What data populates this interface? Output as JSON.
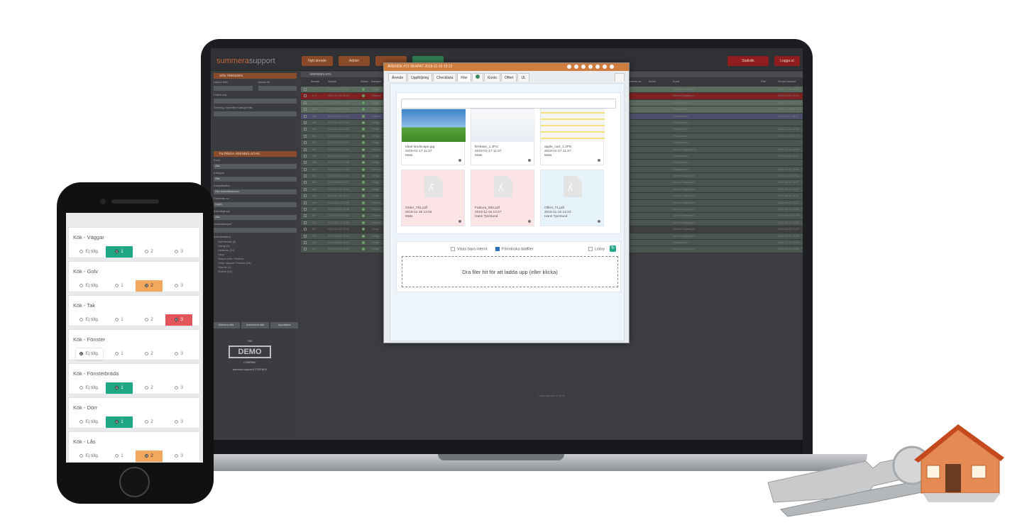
{
  "app": {
    "logo_main": "summera",
    "logo_sub": "support",
    "btn_statistik": "Statistik",
    "btn_logout": "Logga ut",
    "btn_new": "Nytt ärende",
    "btn_admin": "Admin",
    "btn_3": "",
    "btn_4": ""
  },
  "sidebar": {
    "search_header": "SÖK ÄRENDEN",
    "date_from": "Datum från",
    "date_to": "Datum till",
    "free_text": "Fritext sök",
    "search_category": "Sökning i specifikt Kategori fält",
    "filter_header": "FILTRERA ÄRENDELISTAN",
    "kund_label": "Kund",
    "kund_value": "Alla",
    "kategori_label": "Kategori",
    "kategori_value": "Alla",
    "klass_label": "Klassifikation",
    "klass_value": "Alla klassifikationer",
    "handled_label": "Hanteras av",
    "handled_value": "Ingen",
    "group_label": "Ärendegrupp",
    "group_value": "Alla",
    "sub_label": "Underkategori",
    "legend_header": "Ärendestatus",
    "legend": [
      "Nytt ärende (8)",
      "Stängt (3)",
      "Hanteras (14)",
      "Lång",
      "Skapa order i Fortnox",
      "Order skapad i Fortnox (26)",
      "Vilande (1)",
      "Slutfört (21)"
    ],
    "btn_mark_all": "Markera alla",
    "btn_unmark_all": "Avmarkera alla",
    "btn_update": "Uppdatera",
    "demo_the": "THE",
    "demo_main": "DEMO",
    "demo_company": "COMPANY",
    "demo_footer": "summera support & FORTNOX"
  },
  "list": {
    "header": "ÄRENDELISTA",
    "columns": [
      "Ärende",
      "Skapat",
      "Status",
      "Kategori",
      "Hanteras av",
      "Ämne",
      "Kund",
      "Filer",
      "Senast ändrad"
    ],
    "rows": [
      {
        "id": "#70",
        "date": "2019-11-28 13:29",
        "cat": "Övrigt",
        "kund": "Demo Company 07",
        "ch": "2019-12-12 08:52",
        "color": "#5a6a5f"
      },
      {
        "id": "#71",
        "date": "2019-11-15 13:12",
        "cat": "Felanm",
        "kund": "Demo Company 6",
        "ch": "2019-11-15 13:23",
        "color": "#7d2121"
      },
      {
        "id": "#70",
        "date": "2019-11-01 14:23",
        "cat": "Övrigt",
        "kund": "Privatperson",
        "ch": "2019-11-15 10:41",
        "color": "#5a6a5f"
      },
      {
        "id": "#69",
        "date": "2019-10-30 16:16",
        "cat": "Övrigt",
        "kund": "Privatperson",
        "ch": "2019-11-15 12:59",
        "color": "#5a6a5f"
      },
      {
        "id": "#68",
        "date": "2019-10-17 14:27",
        "cat": "Felanm",
        "kund": "Privatperson",
        "ch": "2019-11-14 08:17",
        "color": "#4e4d6b"
      },
      {
        "id": "#65",
        "date": "2019-10-16 14:34",
        "cat": "Övrigt",
        "kund": "Privatperson",
        "ch": "",
        "color": "#4b5550"
      },
      {
        "id": "#64",
        "date": "2019-10-16 14:28",
        "cat": "Övrigt",
        "kund": "Privatperson",
        "ch": "2019-10-26 14:28",
        "color": "#4b5550"
      },
      {
        "id": "#63",
        "date": "2019-10-16 12:03",
        "cat": "Övrigt",
        "kund": "Privatperson",
        "ch": "2019-10-26 12:03",
        "color": "#4b5550"
      },
      {
        "id": "#62",
        "date": "2019-10-17 15:31",
        "cat": "Övrigt",
        "kund": "Privatperson",
        "ch": "",
        "color": "#4b5550"
      },
      {
        "id": "#61",
        "date": "2019-10-11 17:15",
        "cat": "Felanm",
        "kund": "Demo Company 23",
        "ch": "2019-10-16 14:29",
        "color": "#4b5550"
      },
      {
        "id": "#59",
        "date": "2019-10-01 12:44",
        "cat": "Övrigt",
        "kund": "Privatperson",
        "ch": "2019-10-26 13:11",
        "color": "#4b5550"
      },
      {
        "id": "#58",
        "date": "2019-10-01 12:38",
        "cat": "Övrigt",
        "kund": "Privatperson",
        "ch": "",
        "color": "#4b5550"
      },
      {
        "id": "#57",
        "date": "2019-10-01 12:33",
        "cat": "Felanm",
        "kund": "Privatperson",
        "ch": "2019-10-17 15:32",
        "color": "#4b5550"
      },
      {
        "id": "#53",
        "date": "2019-09-12 13:24",
        "cat": "Övrigt",
        "kund": "Demo Company 6",
        "ch": "2019-12-03 13:01",
        "color": "#4b5550"
      },
      {
        "id": "#50",
        "date": "2019-09-05 15:07",
        "cat": "Övrigt",
        "kund": "Demo Company 6",
        "ch": "2019-09-11 13:57",
        "color": "#4b5550"
      },
      {
        "id": "#44",
        "date": "2019-07-18 16:40",
        "cat": "Övrigt",
        "kund": "Demo Company 6",
        "ch": "2019-08-15 13:37",
        "color": "#4b5550"
      },
      {
        "id": "#42",
        "date": "2019-07-18 16:03",
        "cat": "Övrigt",
        "kund": "Demo Company 6",
        "ch": "2019-09-11 13:37",
        "color": "#4b5550"
      },
      {
        "id": "#39",
        "date": "2019-06-27 15:46",
        "cat": "Felanm",
        "kund": "Demo Company 6",
        "ch": "2019-09-09 13:11",
        "color": "#4b5550"
      },
      {
        "id": "#38",
        "date": "2019-06-04 15:48",
        "cat": "Felanm",
        "kund": "Demo Company 3",
        "ch": "2019-06-25 13:00",
        "color": "#4b5550"
      },
      {
        "id": "#37",
        "date": "2019-06-03 15:55",
        "cat": "Felanm",
        "kund": "Demo Company 6",
        "ch": "2019-06-03 10:05",
        "color": "#4b5550"
      },
      {
        "id": "#33",
        "date": "2019-05-14 12:55",
        "cat": "Service",
        "kund": "Demo Company 6",
        "ch": "2019-05-25 13:58",
        "color": "#4b5550"
      },
      {
        "id": "#27",
        "date": "2019-04-26 09:45",
        "cat": "Övrigt",
        "kund": "Demo Company 6",
        "ch": "2019-04-28 13:23",
        "color": "#3e403f"
      },
      {
        "id": "#23",
        "date": "2019-04-26 15:15",
        "cat": "Övrigt",
        "kund": "Demo Company 6",
        "ch": "2019-10-15 15:08",
        "color": "#4b5550"
      },
      {
        "id": "#22",
        "date": "2019-04-25 16:03",
        "cat": "Övrigt",
        "kund": "Privatperson",
        "ch": "2019-07-17 14:29",
        "color": "#4b5550"
      },
      {
        "id": "#1",
        "date": "2019-04-24 13:39",
        "cat": "Övrigt",
        "kund": "Demo Company 6",
        "ch": "2019-04-24 13:36",
        "color": "#4b5550"
      }
    ],
    "footer": "Visar ärenden 1 till 25"
  },
  "modal": {
    "title": "ÄRENDE #71 SKAPAT 2019-11-15 13:12",
    "tabs": [
      "Ärende",
      "Uppföljning",
      "Checklista",
      "Filer",
      "",
      "Konto",
      "Offert",
      "UL"
    ],
    "files": [
      {
        "name": "ideal-landscape.jpg",
        "date": "2019-01-17 11:37",
        "user": "Mats"
      },
      {
        "name": "firebase_1.JPG",
        "date": "2019-01-17 11:37",
        "user": "Mats"
      },
      {
        "name": "apple_cart_1.JPG",
        "date": "2019-01-17 11:37",
        "user": "Mats"
      },
      {
        "name": "Order_751.pdf",
        "date": "2019-11-15 12:04",
        "user": "Mats"
      },
      {
        "name": "Faktura_552.pdf",
        "date": "2019-11-15 13:27",
        "user": "Hans Tjernlund"
      },
      {
        "name": "Offert_71.pdf",
        "date": "2019-11-15 13:23",
        "user": "Hans Tjernlund"
      }
    ],
    "opt_internal": "Visas bara internt",
    "opt_thumbs": "Förminska bildfiler",
    "opt_list": "Listvy",
    "dropzone": "Dra filer hit för att ladda upp (eller klicka)",
    "colors": {
      "pdf_pink": "#fbe3e6",
      "pdf_blue": "#e6f3fb",
      "title": "#cf7c3f"
    }
  },
  "phone": {
    "items": [
      {
        "title": "Kök - Väggar",
        "selected": 1,
        "color": "green"
      },
      {
        "title": "Kök - Golv",
        "selected": 2,
        "color": "orange"
      },
      {
        "title": "Kök - Tak",
        "selected": 3,
        "color": "red"
      },
      {
        "title": "Kök - Fönster",
        "selected": 0,
        "color": "white"
      },
      {
        "title": "Kök - Fönsterbräda",
        "selected": 1,
        "color": "green"
      },
      {
        "title": "Kök - Dörr",
        "selected": 1,
        "color": "green"
      },
      {
        "title": "Kök - Lås",
        "selected": 2,
        "color": "orange"
      }
    ],
    "options": [
      "Ej tillg.",
      "1",
      "2",
      "3"
    ]
  }
}
